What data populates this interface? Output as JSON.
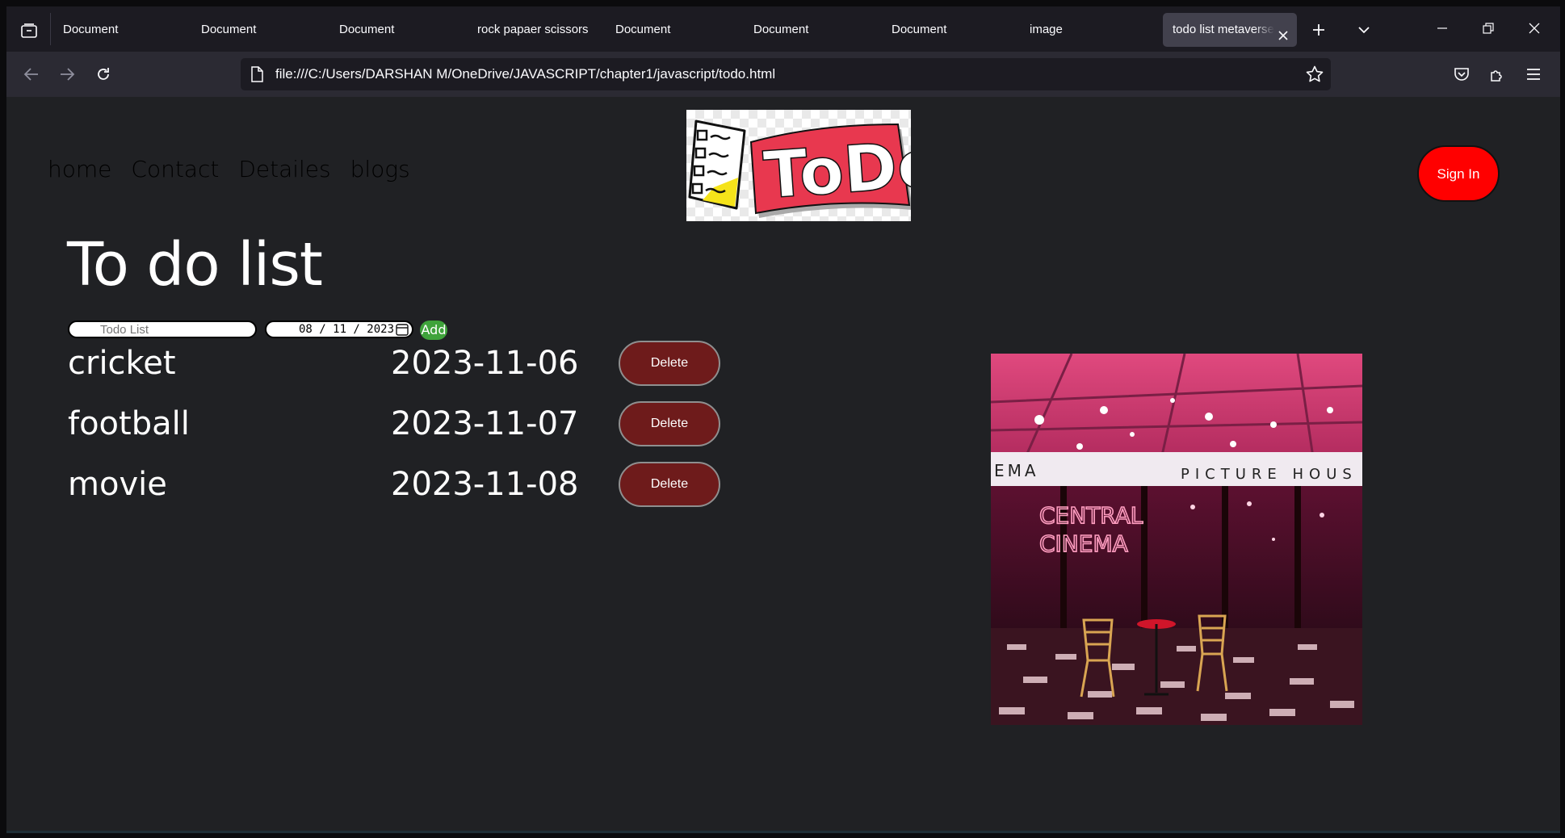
{
  "browser": {
    "tabs": [
      {
        "label": "Document"
      },
      {
        "label": "Document"
      },
      {
        "label": "Document"
      },
      {
        "label": "rock papaer scissors"
      },
      {
        "label": "Document"
      },
      {
        "label": "Document"
      },
      {
        "label": "Document"
      },
      {
        "label": "image"
      },
      {
        "label": "todo list metaverse",
        "active": true
      }
    ],
    "url": "file:///C:/Users/DARSHAN M/OneDrive/JAVASCRIPT/chapter1/javascript/todo.html"
  },
  "site": {
    "nav": [
      "home",
      "Contact",
      "Detailes",
      "blogs"
    ],
    "logo_text": "ToDo",
    "signin_label": "Sign In"
  },
  "main": {
    "title": "To do list",
    "todo_placeholder": "Todo List",
    "date_value": "08 / 11 / 2023",
    "add_label": "Add",
    "items": [
      {
        "name": "cricket",
        "date": "2023-11-06",
        "delete_label": "Delete"
      },
      {
        "name": "football",
        "date": "2023-11-07",
        "delete_label": "Delete"
      },
      {
        "name": "movie",
        "date": "2023-11-08",
        "delete_label": "Delete"
      }
    ],
    "photo": {
      "sign_left": "EMA",
      "sign_right": "PICTURE HOUS",
      "neon_line1": "CENTRAL",
      "neon_line2": "CINEMA"
    }
  },
  "colors": {
    "signin_bg": "#ff0000",
    "delete_bg": "#6e1b1b",
    "add_bg": "#3fa33b",
    "page_bg": "#202124"
  }
}
